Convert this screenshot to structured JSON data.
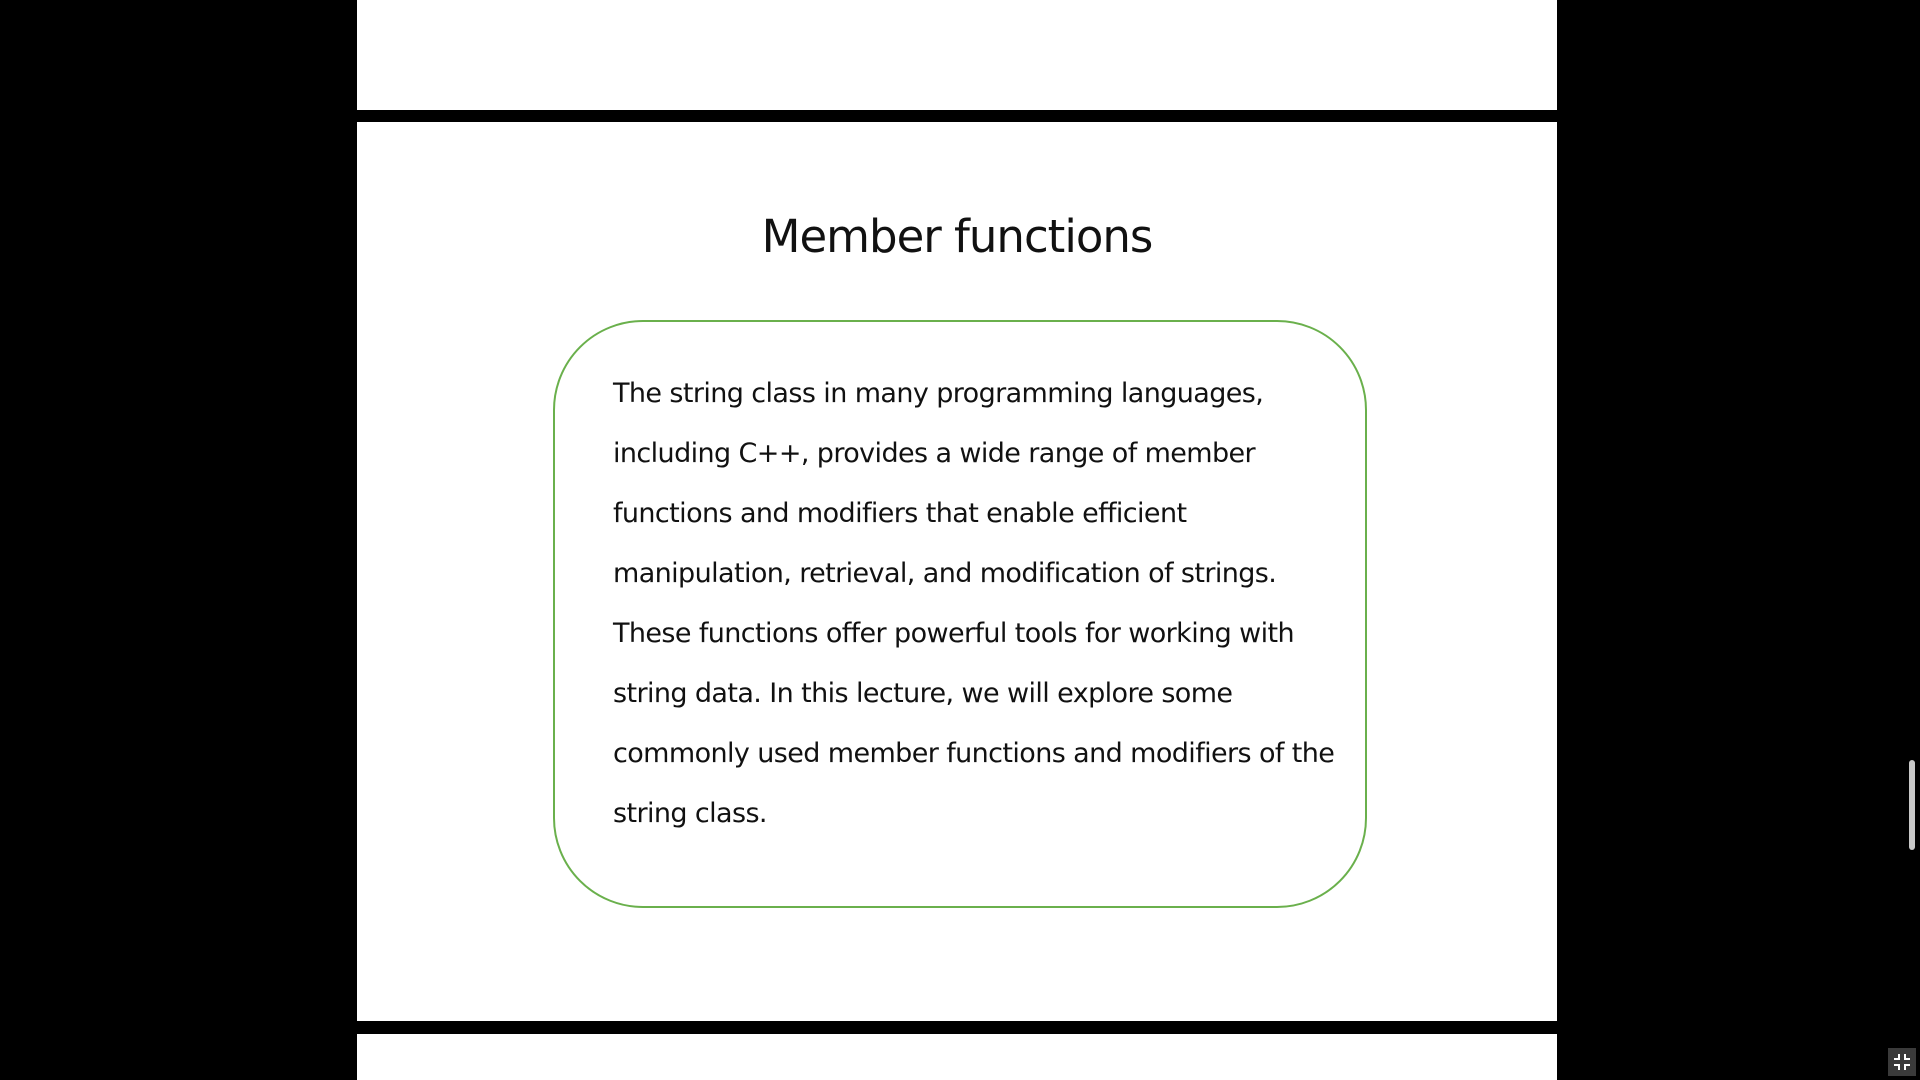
{
  "slide": {
    "title": "Member functions",
    "body": "The string class in many programming languages, including C++, provides a wide range of member functions and modifiers that enable efficient manipulation, retrieval, and modification of strings. These functions offer powerful tools for working with string data. In this lecture, we will explore some commonly used member functions and modifiers of the string class.",
    "box_border_color": "#6ab04c"
  },
  "controls": {
    "exit_fullscreen_icon": "exit-fullscreen-icon"
  }
}
